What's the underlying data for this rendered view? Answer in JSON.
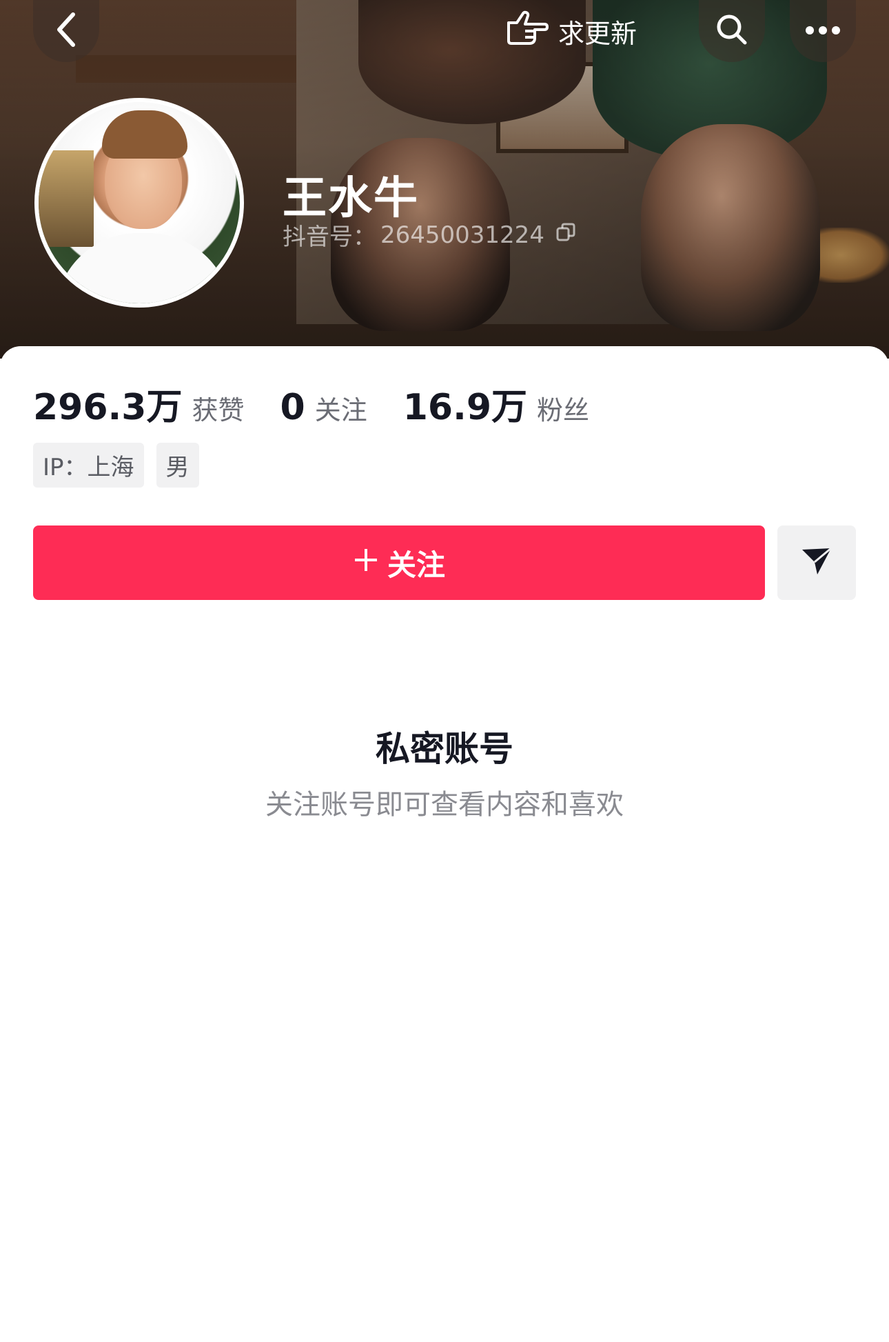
{
  "header": {
    "update_label": "求更新",
    "icons": {
      "back": "chevron-left-icon",
      "search": "search-icon",
      "more": "more-dots-icon",
      "update": "pointing-hand-icon",
      "copy": "copy-icon"
    }
  },
  "profile": {
    "name": "王水牛",
    "douyin_id_label": "抖音号：",
    "douyin_id": "26450031224"
  },
  "stats": [
    {
      "value": "296.3万",
      "label": "获赞"
    },
    {
      "value": "0",
      "label": "关注"
    },
    {
      "value": "16.9万",
      "label": "粉丝"
    }
  ],
  "tags": [
    "IP：上海",
    "男"
  ],
  "actions": {
    "follow_label": "关注",
    "follow_prefix": "+",
    "message_icon": "send-icon"
  },
  "private": {
    "title": "私密账号",
    "subtitle": "关注账号即可查看内容和喜欢"
  },
  "colors": {
    "accent": "#fe2c55",
    "text_primary": "#161823",
    "text_secondary": "#8a8b91"
  }
}
